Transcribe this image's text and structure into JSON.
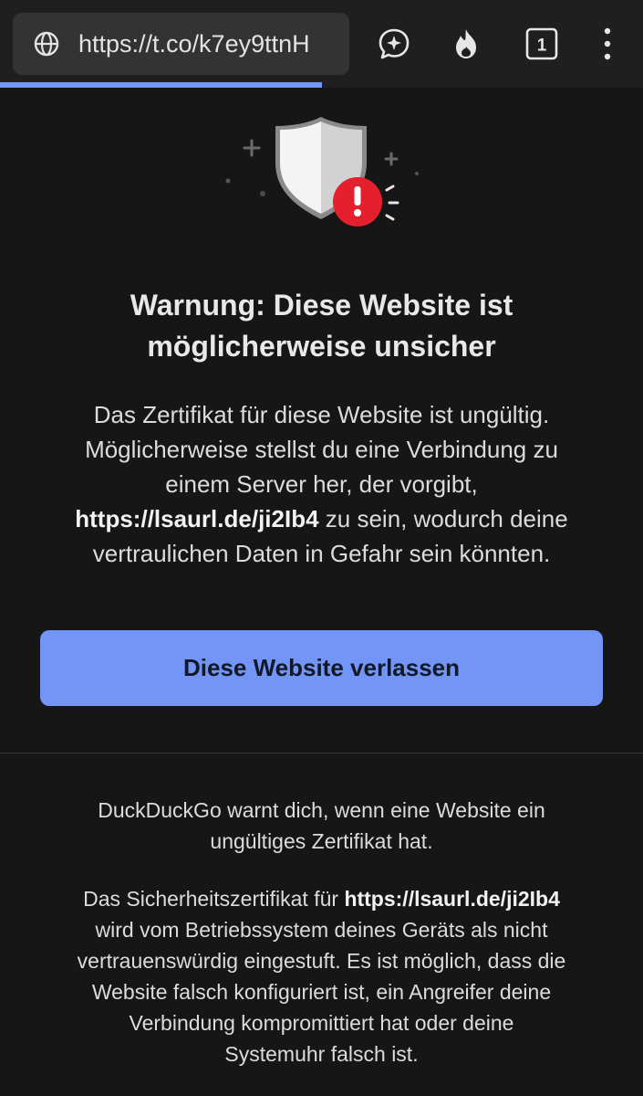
{
  "browser": {
    "url": "https://t.co/k7ey9ttnH",
    "tab_count": "1",
    "load_progress": 0.5,
    "icons": [
      "globe-icon",
      "duck-ai-chat-icon",
      "fire-icon",
      "tab-switcher-icon",
      "overflow-menu-icon"
    ]
  },
  "warning": {
    "title_line1": "Warnung: Diese Website ist",
    "title_line2": "möglicherweise unsicher",
    "body_line1": "Das Zertifikat für diese Website ist ungültig.",
    "body_line2": "Möglicherweise stellst du eine Verbindung zu",
    "body_line3": "einem Server her, der vorgibt,",
    "body_domain": "https://lsaurl.de/ji2Ib4",
    "body_line4_rest": " zu sein, wodurch deine",
    "body_line5": "vertraulichen Daten in Gefahr sein könnten.",
    "leave_button": "Diese Website verlassen"
  },
  "details": {
    "para1_line1": "DuckDuckGo warnt dich, wenn eine Website ein",
    "para1_line2": "ungültiges Zertifikat hat.",
    "para2_prefix": "Das Sicherheitszertifikat für ",
    "para2_domain": "https://lsaurl.de/ji2Ib4",
    "para2_line2": "wird vom Betriebssystem deines Geräts als nicht",
    "para2_line3": "vertrauenswürdig eingestuft. Es ist möglich, dass die",
    "para2_line4": "Website falsch konfiguriert ist, ein Angreifer deine",
    "para2_line5": "Verbindung kompromittiert hat oder deine",
    "para2_line6": "Systemuhr falsch ist."
  },
  "colors": {
    "accent": "#7295f6",
    "background": "#161616",
    "toolbar": "#1f1f1f",
    "alert_red": "#e4202e"
  }
}
